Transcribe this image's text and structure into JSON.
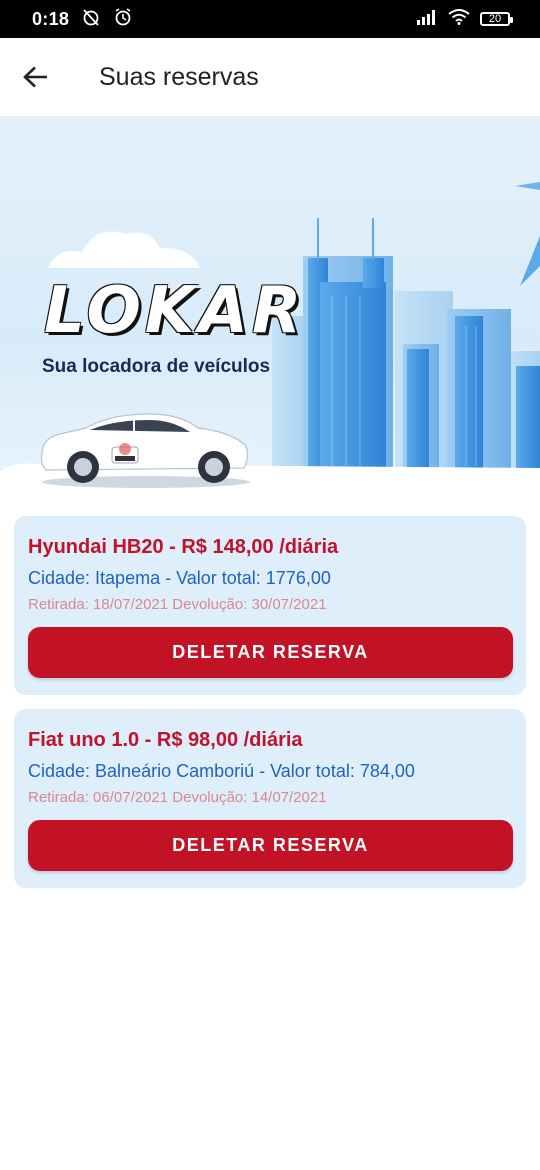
{
  "status_bar": {
    "time": "0:18",
    "battery": "20"
  },
  "app_bar": {
    "title": "Suas reservas"
  },
  "hero": {
    "logo": "LOKAR",
    "tagline": "Sua locadora de veículos"
  },
  "reservations": [
    {
      "title": "Hyundai HB20 - R$ 148,00 /diária",
      "city_total": "Cidade: Itapema - Valor total: 1776,00",
      "dates": "Retirada: 18/07/2021 Devolução: 30/07/2021",
      "delete_label": "DELETAR RESERVA"
    },
    {
      "title": "Fiat uno 1.0 - R$ 98,00 /diária",
      "city_total": "Cidade: Balneário Camboriú - Valor total: 784,00",
      "dates": "Retirada: 06/07/2021 Devolução: 14/07/2021",
      "delete_label": "DELETAR RESERVA"
    }
  ],
  "colors": {
    "accent": "#c11226",
    "title_red": "#c0132a",
    "link_blue": "#1d64c2",
    "card_bg": "#dfeefb"
  }
}
